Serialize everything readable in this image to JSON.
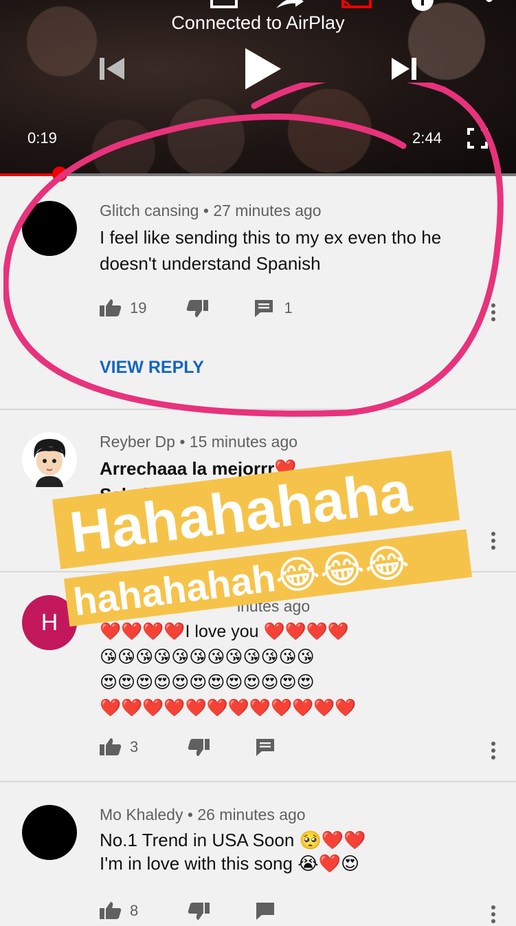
{
  "player": {
    "status": "Connected to AirPlay",
    "elapsed": "0:19",
    "duration": "2:44",
    "progress_fraction": 0.116
  },
  "comments": [
    {
      "author": "Glitch cansing",
      "age": "27 minutes ago",
      "text_line1": "I feel like sending this to my ex even tho he",
      "text_line2": "doesn't understand Spanish",
      "likes": "19",
      "replies": "1",
      "view_reply": "VIEW REPLY"
    },
    {
      "author": "Reyber Dp",
      "age": "15 minutes ago",
      "text_line1": "Arrechaaa la mejorrr❤️",
      "text_line2": "Saludos desde V"
    },
    {
      "avatar_letter": "H",
      "meta_partial": "inutes ago",
      "text_line1": "❤️❤️❤️❤️I love you ❤️❤️❤️❤️",
      "text_line2": "😘😘😘😘😘😘😘😘😘😘😘😘",
      "text_line3": "😍😍😍😍😍😍😍😍😍😍😍😍",
      "text_line4": "❤️❤️❤️❤️❤️❤️❤️❤️❤️❤️❤️❤️",
      "likes": "3",
      "avatar_color": "#c2185b"
    },
    {
      "author": "Mo Khaledy",
      "age": "26 minutes ago",
      "text_line1": "No.1 Trend in USA Soon 🥺❤️❤️",
      "text_line2": "I'm in love with this song 😭❤️😍",
      "likes": "8"
    }
  ],
  "sticker": {
    "line1": "Hahahahaha",
    "line2": "hahahahah😂😂😂",
    "color": "#f6c34a"
  },
  "annotation_color": "#e8327c",
  "separator": "•"
}
